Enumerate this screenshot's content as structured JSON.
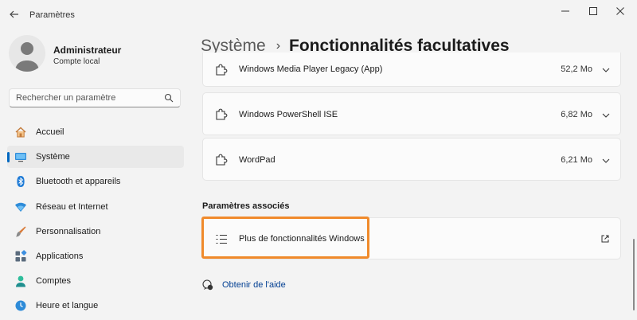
{
  "window": {
    "title": "Paramètres"
  },
  "profile": {
    "name": "Administrateur",
    "account_type": "Compte local"
  },
  "search": {
    "placeholder": "Rechercher un paramètre"
  },
  "sidebar": {
    "items": [
      {
        "label": "Accueil",
        "icon": "home-icon",
        "selected": false
      },
      {
        "label": "Système",
        "icon": "display-icon",
        "selected": true
      },
      {
        "label": "Bluetooth et appareils",
        "icon": "bluetooth-icon",
        "selected": false
      },
      {
        "label": "Réseau et Internet",
        "icon": "wifi-icon",
        "selected": false
      },
      {
        "label": "Personnalisation",
        "icon": "brush-icon",
        "selected": false
      },
      {
        "label": "Applications",
        "icon": "apps-icon",
        "selected": false
      },
      {
        "label": "Comptes",
        "icon": "person-icon",
        "selected": false
      },
      {
        "label": "Heure et langue",
        "icon": "globe-clock-icon",
        "selected": false
      }
    ]
  },
  "breadcrumb": {
    "parent": "Système",
    "current": "Fonctionnalités facultatives"
  },
  "features": [
    {
      "name": "Windows Media Player Legacy (App)",
      "size": "52,2 Mo"
    },
    {
      "name": "Windows PowerShell ISE",
      "size": "6,82 Mo"
    },
    {
      "name": "WordPad",
      "size": "6,21 Mo"
    }
  ],
  "related": {
    "heading": "Paramètres associés",
    "item_label": "Plus de fonctionnalités Windows"
  },
  "help": {
    "label": "Obtenir de l'aide"
  },
  "colors": {
    "accent": "#0067c0",
    "highlight": "#f08a2b",
    "link": "#003e92"
  }
}
